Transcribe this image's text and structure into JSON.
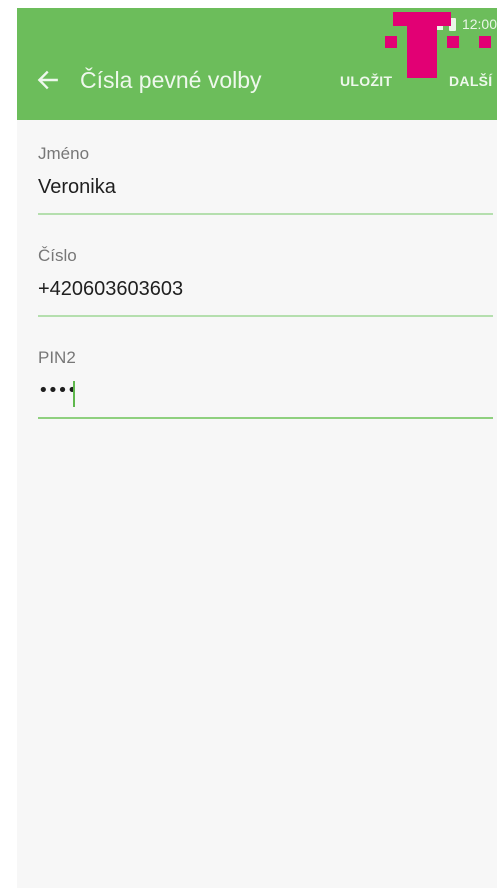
{
  "status_bar": {
    "time": "12:00",
    "icons": [
      "nfc-icon",
      "signal-icon",
      "battery-icon"
    ]
  },
  "toolbar": {
    "back_icon": "arrow-left-icon",
    "title": "Čísla pevné volby",
    "save_label": "ULOŽIT",
    "next_label": "DALŠÍ"
  },
  "form": {
    "name": {
      "label": "Jméno",
      "value": "Veronika"
    },
    "number": {
      "label": "Číslo",
      "value": "+420603603603"
    },
    "pin2": {
      "label": "PIN2",
      "value": "••••"
    }
  },
  "colors": {
    "app_bar": "#6cbd5b",
    "brand_logo": "#e20074",
    "field_underline": "#b5dfae",
    "cursor": "#5fb84d"
  }
}
